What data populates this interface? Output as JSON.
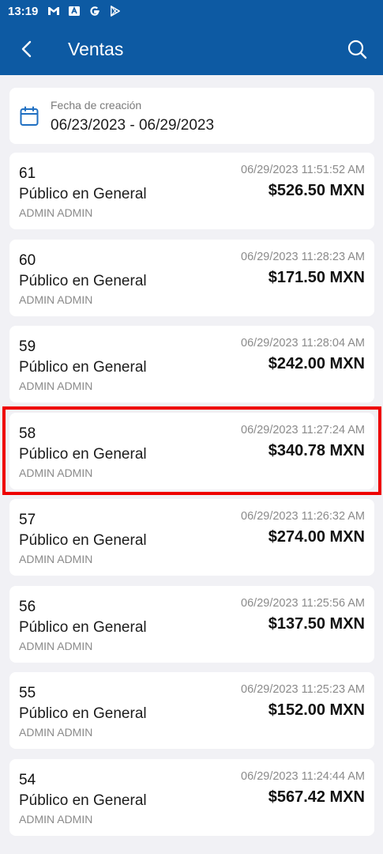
{
  "status_bar": {
    "time": "13:19",
    "icons": [
      "gmail-icon",
      "news-icon",
      "google-icon",
      "play-store-icon"
    ]
  },
  "app_bar": {
    "title": "Ventas",
    "back_icon": "back-arrow-icon",
    "search_icon": "search-icon",
    "color": "#0d5aa3"
  },
  "date_filter": {
    "label": "Fecha de creación",
    "range": "06/23/2023 - 06/29/2023",
    "icon": "calendar-icon"
  },
  "sales": [
    {
      "id": "61",
      "client": "Público en General",
      "user": "ADMIN ADMIN",
      "datetime": "06/29/2023 11:51:52 AM",
      "amount": "$526.50 MXN"
    },
    {
      "id": "60",
      "client": "Público en General",
      "user": "ADMIN ADMIN",
      "datetime": "06/29/2023 11:28:23 AM",
      "amount": "$171.50 MXN"
    },
    {
      "id": "59",
      "client": "Público en General",
      "user": "ADMIN ADMIN",
      "datetime": "06/29/2023 11:28:04 AM",
      "amount": "$242.00 MXN"
    },
    {
      "id": "58",
      "client": "Público en General",
      "user": "ADMIN ADMIN",
      "datetime": "06/29/2023 11:27:24 AM",
      "amount": "$340.78 MXN"
    },
    {
      "id": "57",
      "client": "Público en General",
      "user": "ADMIN ADMIN",
      "datetime": "06/29/2023 11:26:32 AM",
      "amount": "$274.00 MXN"
    },
    {
      "id": "56",
      "client": "Público en General",
      "user": "ADMIN ADMIN",
      "datetime": "06/29/2023 11:25:56 AM",
      "amount": "$137.50 MXN"
    },
    {
      "id": "55",
      "client": "Público en General",
      "user": "ADMIN ADMIN",
      "datetime": "06/29/2023 11:25:23 AM",
      "amount": "$152.00 MXN"
    },
    {
      "id": "54",
      "client": "Público en General",
      "user": "ADMIN ADMIN",
      "datetime": "06/29/2023 11:24:44 AM",
      "amount": "$567.42 MXN"
    }
  ],
  "highlighted_sale": "58",
  "highlight_color": "#ee0000"
}
